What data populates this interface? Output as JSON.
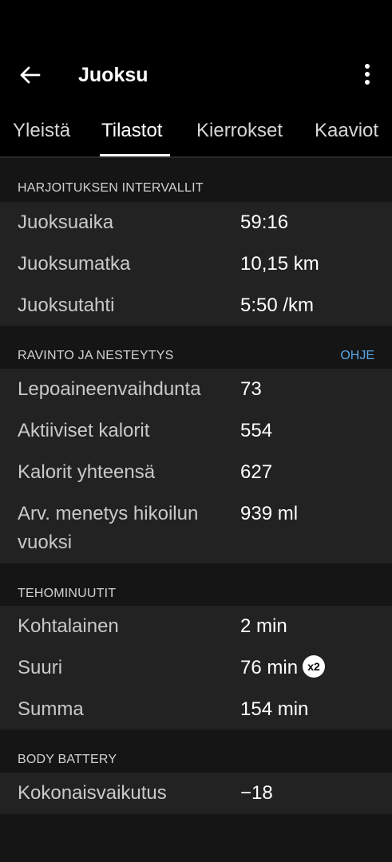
{
  "header": {
    "title": "Juoksu"
  },
  "tabs": [
    {
      "label": "Yleistä"
    },
    {
      "label": "Tilastot"
    },
    {
      "label": "Kierrokset"
    },
    {
      "label": "Kaaviot"
    }
  ],
  "active_tab": "Tilastot",
  "sections": {
    "intervals": {
      "title": "HARJOITUKSEN INTERVALLIT",
      "rows": [
        {
          "label": "Juoksuaika",
          "value": "59:16"
        },
        {
          "label": "Juoksumatka",
          "value": "10,15 km"
        },
        {
          "label": "Juoksutahti",
          "value": "5:50 /km"
        }
      ]
    },
    "nutrition": {
      "title": "RAVINTO JA NESTEYTYS",
      "link": "OHJE",
      "rows": [
        {
          "label": "Lepoaineenvaihdunta",
          "value": "73"
        },
        {
          "label": "Aktiiviset kalorit",
          "value": "554"
        },
        {
          "label": "Kalorit yhteensä",
          "value": "627"
        },
        {
          "label": "Arv. menetys hikoilun vuoksi",
          "value": "939 ml"
        }
      ]
    },
    "intensity": {
      "title": "TEHOMINUUTIT",
      "rows": [
        {
          "label": "Kohtalainen",
          "value": "2 min"
        },
        {
          "label": "Suuri",
          "value": "76 min",
          "badge": "x2"
        },
        {
          "label": "Summa",
          "value": "154 min"
        }
      ]
    },
    "body_battery": {
      "title": "BODY BATTERY",
      "rows": [
        {
          "label": "Kokonaisvaikutus",
          "value": "−18"
        }
      ]
    }
  },
  "colors": {
    "background": "#000000",
    "card": "#222222",
    "section_header": "#151515",
    "link": "#5aa7e8"
  },
  "icons": {
    "back": "arrow-left-icon",
    "more": "more-vertical-icon",
    "badge": "multiplier-badge"
  }
}
